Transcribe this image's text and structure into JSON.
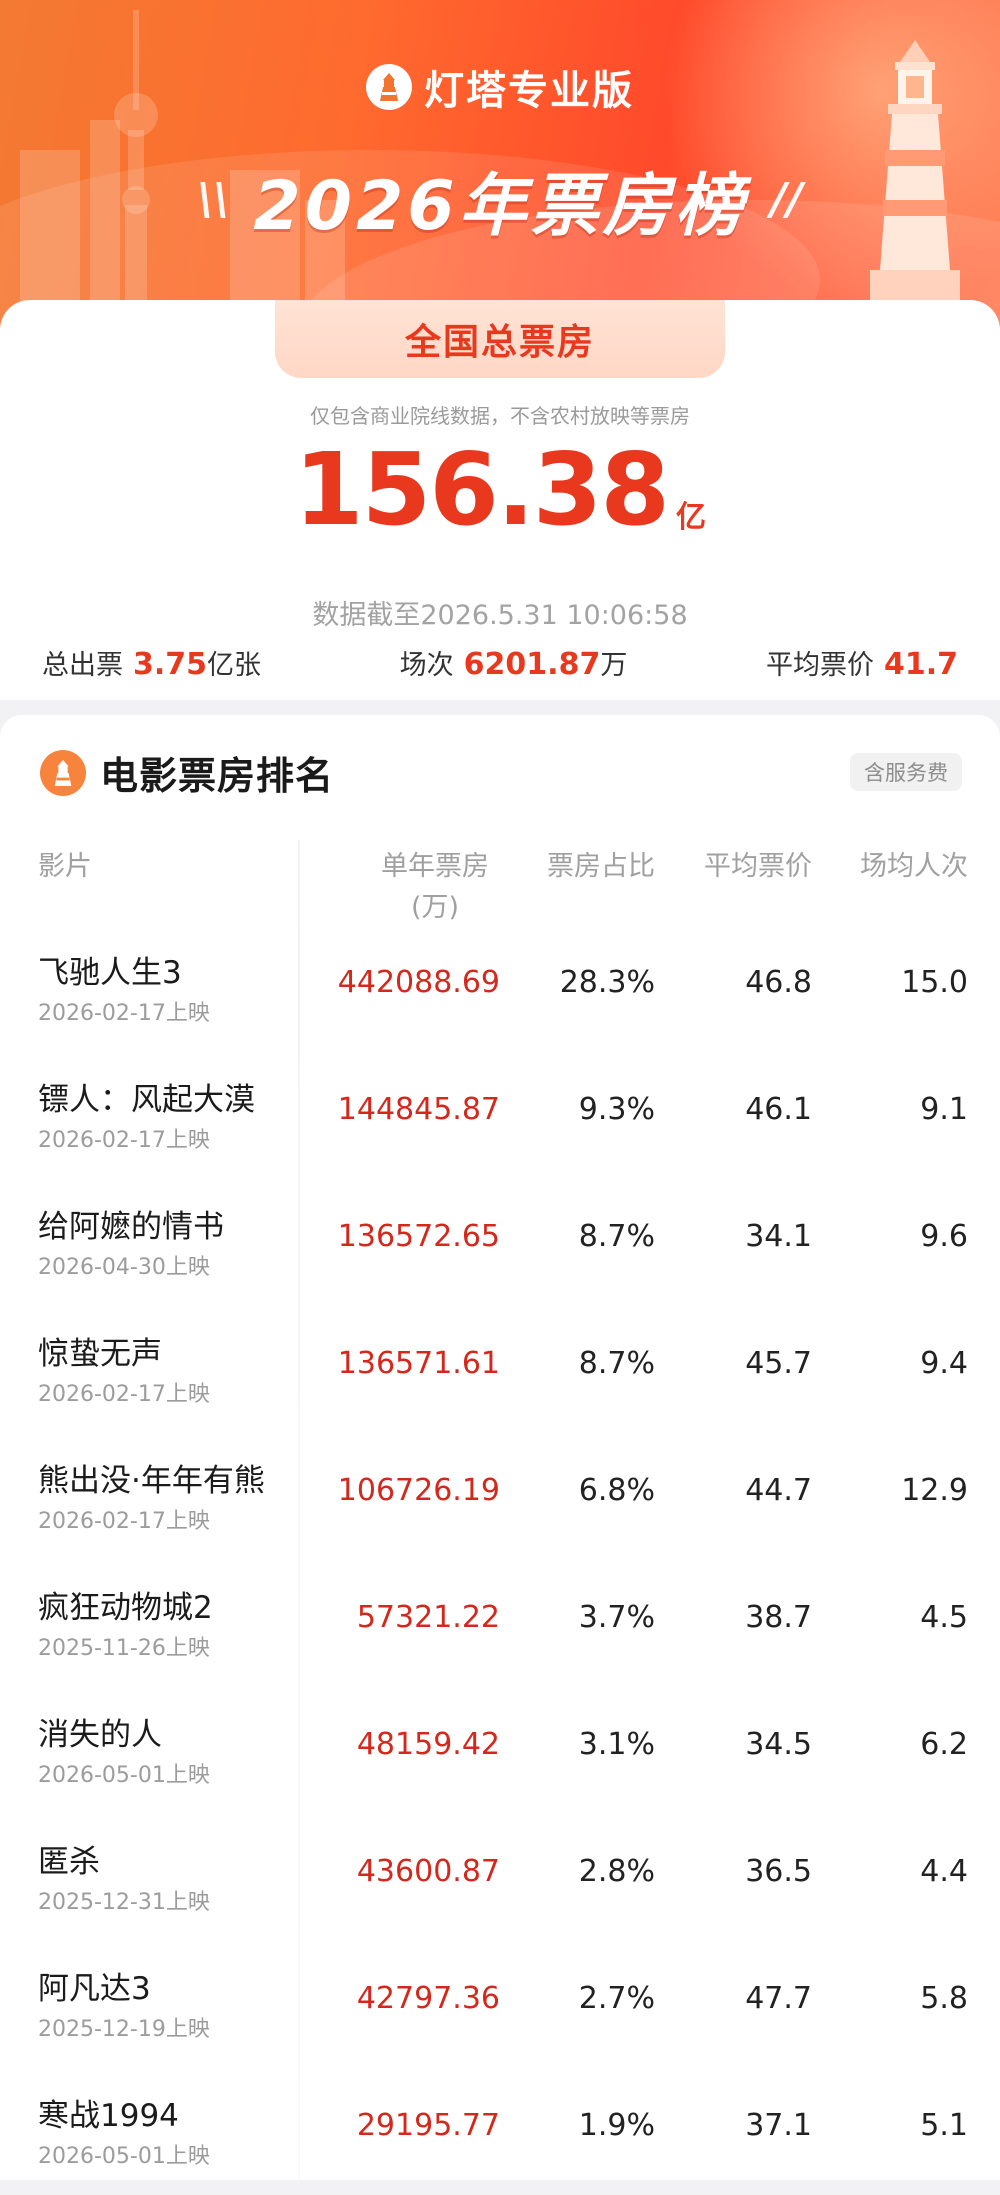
{
  "header": {
    "brand": "灯塔专业版",
    "title": "2026年票房榜",
    "title_deco_left": "\\\\",
    "title_deco_right": "//"
  },
  "summary": {
    "tab_label": "全国总票房",
    "note": "仅包含商业院线数据，不含农村放映等票房",
    "total_value": "156.38",
    "total_unit": "亿",
    "timestamp": "数据截至2026.5.31 10:06:58",
    "stats": [
      {
        "label": "总出票",
        "value": "3.75",
        "unit": "亿张"
      },
      {
        "label": "场次",
        "value": "6201.87",
        "unit": "万"
      },
      {
        "label": "平均票价",
        "value": "41.7",
        "unit": ""
      }
    ]
  },
  "ranking": {
    "title": "电影票房排名",
    "fee_badge": "含服务费",
    "columns": {
      "film": "影片",
      "box": "单年票房\n(万)",
      "share": "票房占比",
      "avg_price": "平均票价",
      "avg_audience": "场均人次"
    },
    "rows": [
      {
        "name": "飞驰人生3",
        "date": "2026-02-17上映",
        "box": "442088.69",
        "share": "28.3%",
        "price": "46.8",
        "audience": "15.0"
      },
      {
        "name": "镖人：风起大漠",
        "date": "2026-02-17上映",
        "box": "144845.87",
        "share": "9.3%",
        "price": "46.1",
        "audience": "9.1"
      },
      {
        "name": "给阿嬷的情书",
        "date": "2026-04-30上映",
        "box": "136572.65",
        "share": "8.7%",
        "price": "34.1",
        "audience": "9.6"
      },
      {
        "name": "惊蛰无声",
        "date": "2026-02-17上映",
        "box": "136571.61",
        "share": "8.7%",
        "price": "45.7",
        "audience": "9.4"
      },
      {
        "name": "熊出没·年年有熊",
        "date": "2026-02-17上映",
        "box": "106726.19",
        "share": "6.8%",
        "price": "44.7",
        "audience": "12.9"
      },
      {
        "name": "疯狂动物城2",
        "date": "2025-11-26上映",
        "box": "57321.22",
        "share": "3.7%",
        "price": "38.7",
        "audience": "4.5"
      },
      {
        "name": "消失的人",
        "date": "2026-05-01上映",
        "box": "48159.42",
        "share": "3.1%",
        "price": "34.5",
        "audience": "6.2"
      },
      {
        "name": "匿杀",
        "date": "2025-12-31上映",
        "box": "43600.87",
        "share": "2.8%",
        "price": "36.5",
        "audience": "4.4"
      },
      {
        "name": "阿凡达3",
        "date": "2025-12-19上映",
        "box": "42797.36",
        "share": "2.7%",
        "price": "47.7",
        "audience": "5.8"
      },
      {
        "name": "寒战1994",
        "date": "2026-05-01上映",
        "box": "29195.77",
        "share": "1.9%",
        "price": "37.1",
        "audience": "5.1"
      }
    ]
  },
  "colors": {
    "accent": "#e8391f",
    "banner": "#ff5a2c",
    "muted": "#9c9c9c"
  }
}
